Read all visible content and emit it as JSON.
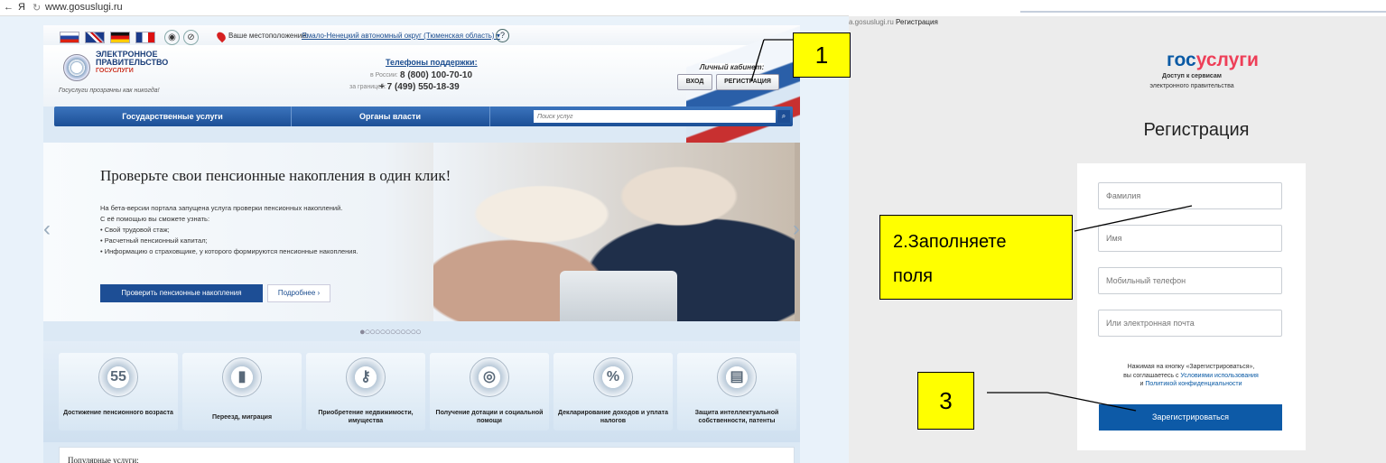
{
  "left_browser": {
    "url": "www.gosuslugi.ru",
    "location_label": "Ваше местоположение:",
    "location_value": "Ямало-Ненецкий автономный округ (Тюменская область) ▾",
    "help_icon": "?",
    "logo": {
      "line1": "ЭЛЕКТРОННОЕ",
      "line2": "ПРАВИТЕЛЬСТВО",
      "line3": "ГОСУСЛУГИ",
      "slogan": "Госуслуги прозрачны как никогда!"
    },
    "phones": {
      "title": "Телефоны поддержки:",
      "russia_label": "в России:",
      "russia_number": "8 (800) 100-70-10",
      "abroad_label": "за границей:",
      "abroad_number": "+ 7 (499) 550-18-39"
    },
    "cabinet": {
      "title": "Личный кабинет:",
      "login": "ВХОД",
      "register": "РЕГИСТРАЦИЯ"
    },
    "nav": {
      "item1": "Государственные услуги",
      "item2": "Органы власти",
      "search_placeholder": "Поиск услуг"
    },
    "banner": {
      "title": "Проверьте свои пенсионные накопления в один клик!",
      "text1": "На бета-версии портала запущена услуга проверки пенсионных накоплений.",
      "text2": "С её помощью вы сможете узнать:",
      "bullets": [
        "•  Свой трудовой стаж;",
        "•  Расчетный пенсионный капитал;",
        "•  Информацию о страховщике, у которого формируются пенсионные накопления."
      ],
      "check_button": "Проверить пенсионные накопления",
      "more_button": "Подробнее  ›",
      "dots": "●○○○○○○○○○○○"
    },
    "services": [
      {
        "icon": "55",
        "label": "Достижение пенсионного возраста"
      },
      {
        "icon": "",
        "label": "Переезд, миграция"
      },
      {
        "icon": "",
        "label": "Приобретение недвижимости, имущества"
      },
      {
        "icon": "",
        "label": "Получение дотации и социальной помощи"
      },
      {
        "icon": "%",
        "label": "Декларирование доходов и уплата налогов"
      },
      {
        "icon": "",
        "label": "Защита интеллектуальной собственности, патенты"
      }
    ],
    "popular": "Популярные услуги:"
  },
  "right_browser": {
    "url_host": "a.gosuslugi.ru",
    "url_title": "Регистрация",
    "logo_part1": "гос",
    "logo_part2": "услуги",
    "sub1": "Доступ к сервисам",
    "sub2": "электронного правительства",
    "title": "Регистрация",
    "fields": {
      "surname": "Фамилия",
      "name": "Имя",
      "phone": "Мобильный телефон",
      "email": "Или электронная почта"
    },
    "note_line1": "Нажимая на кнопку «Зарегистрироваться»,",
    "note_line2a": "вы соглашаетесь с ",
    "note_link1": "Условиями использования",
    "note_line3a": "и ",
    "note_link2": "Политикой конфиденциальности",
    "submit": "Зарегистрироваться"
  },
  "annotations": {
    "step1": "1",
    "step2_line1": "2.Заполняете",
    "step2_line2": "поля",
    "step3": "3"
  },
  "colors": {
    "gosuslugi_blue": "#0d5aa7",
    "gosuslugi_red": "#ee3f58",
    "callout_yellow": "#ffff00"
  }
}
